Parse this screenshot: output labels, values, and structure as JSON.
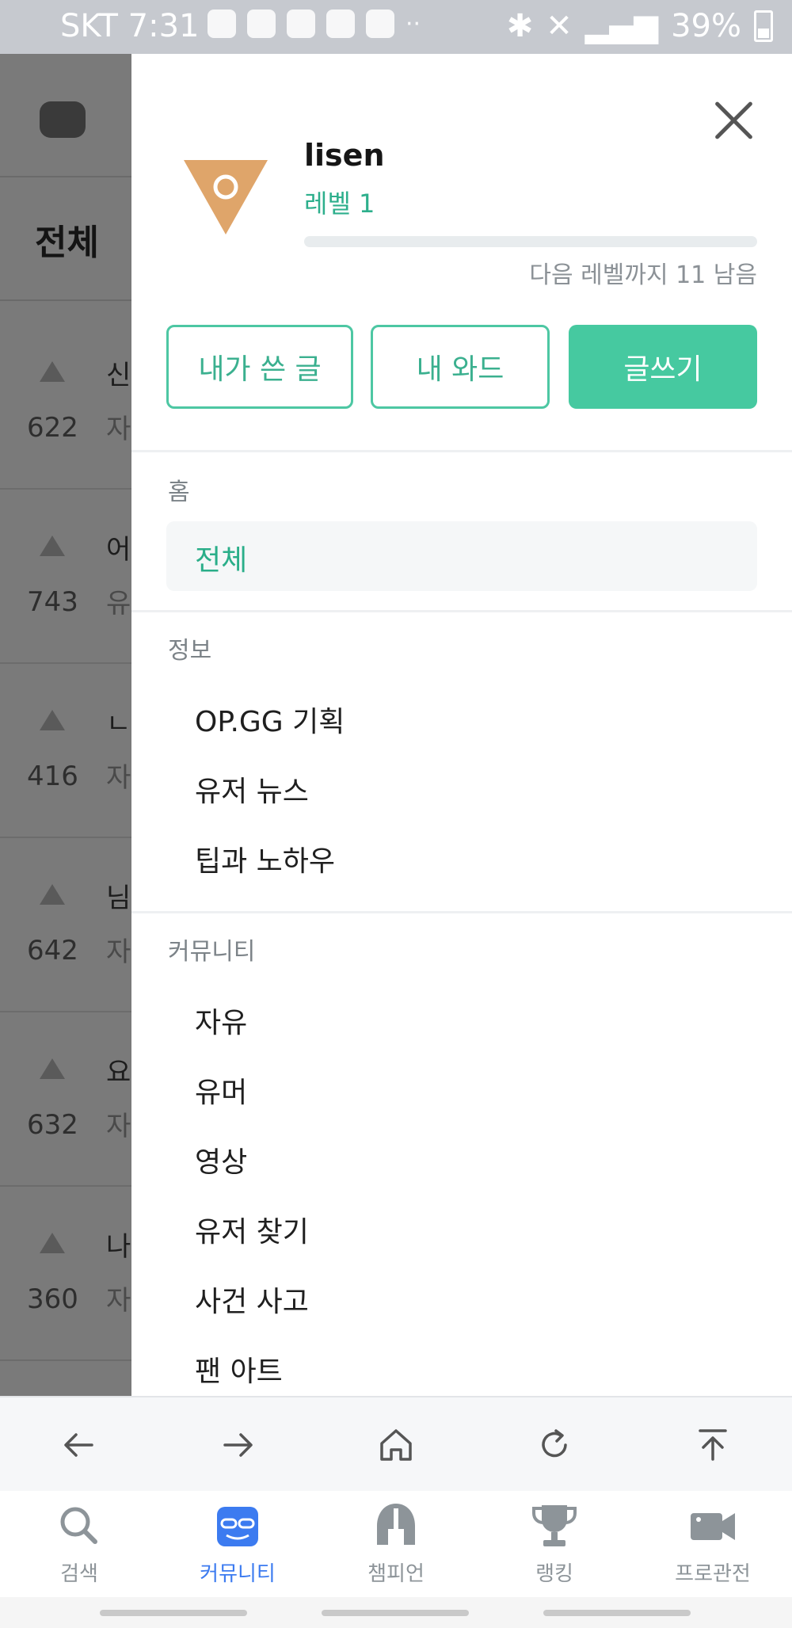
{
  "status_bar": {
    "carrier_time": "SKT 7:31",
    "overflow_dots": "··",
    "battery": "39%"
  },
  "background_page": {
    "tab": "전체",
    "rows": [
      {
        "votes": "622",
        "title_fragment": "신",
        "sub_fragment": "자"
      },
      {
        "votes": "743",
        "title_fragment": "어",
        "sub_fragment": "유"
      },
      {
        "votes": "416",
        "title_fragment": "ㄴ",
        "sub_fragment": "자"
      },
      {
        "votes": "642",
        "title_fragment": "님",
        "sub_fragment": "자"
      },
      {
        "votes": "632",
        "title_fragment": "요",
        "sub_fragment": "자"
      },
      {
        "votes": "360",
        "title_fragment": "나",
        "sub_fragment": "자"
      }
    ]
  },
  "drawer": {
    "username": "lisen",
    "level": "레벨 1",
    "level_progress": 0.0,
    "next_level_text": "다음 레벨까지 11 남음",
    "buttons": {
      "my_posts": "내가 쓴 글",
      "my_ward": "내 와드",
      "write": "글쓰기"
    },
    "sections": {
      "home": {
        "title": "홈",
        "items": [
          "전체"
        ]
      },
      "info": {
        "title": "정보",
        "items": [
          "OP.GG 기획",
          "유저 뉴스",
          "팁과 노하우"
        ]
      },
      "community": {
        "title": "커뮤니티",
        "items": [
          "자유",
          "유머",
          "영상",
          "유저 찾기",
          "사건 사고",
          "팬 아트"
        ]
      }
    },
    "accent_color": "#46c9a0"
  },
  "bottom_nav": {
    "items": [
      "검색",
      "커뮤니티",
      "챔피언",
      "랭킹",
      "프로관전"
    ],
    "active": "커뮤니티"
  }
}
